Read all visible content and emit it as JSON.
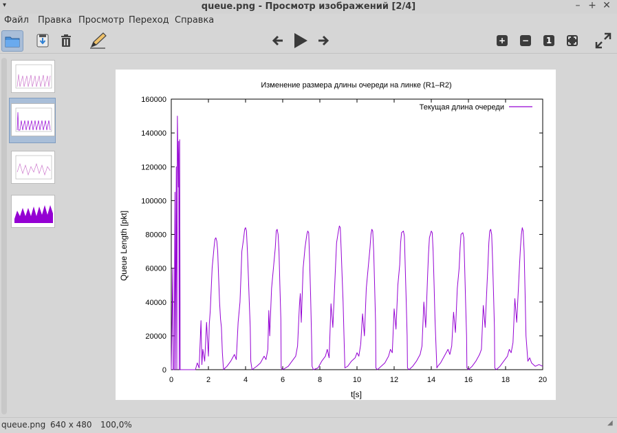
{
  "window": {
    "title": "queue.png - Просмотр изображений [2/4]",
    "menu_glyph": "▾",
    "minimize": "–",
    "maximize": "+",
    "close": "✕"
  },
  "menubar": {
    "items": [
      "Файл",
      "Правка",
      "Просмотр",
      "Переход",
      "Справка"
    ]
  },
  "toolbar": {
    "icons": [
      "folder-icon",
      "save-icon",
      "trash-icon",
      "edit-icon",
      "arrow-left-icon",
      "play-icon",
      "arrow-right-icon",
      "zoom-in-icon",
      "zoom-out-icon",
      "zoom-100-icon",
      "zoom-fit-icon",
      "fullscreen-icon"
    ],
    "zoom_in": "+",
    "zoom_out": "−",
    "zoom_100": "1"
  },
  "status": {
    "filename": "queue.png",
    "dimensions": "640 x 480",
    "zoom": "100,0%"
  },
  "colors": {
    "series": "#9400d3",
    "selection": "#a9bed8"
  },
  "chart_data": {
    "type": "line",
    "title": "Изменение размера длины очереди на линке (R1–R2)",
    "xlabel": "t[s]",
    "ylabel": "Queue Length [pkt]",
    "xlim": [
      0,
      20
    ],
    "ylim": [
      0,
      160000
    ],
    "xticks": [
      0,
      2,
      4,
      6,
      8,
      10,
      12,
      14,
      16,
      18,
      20
    ],
    "yticks": [
      0,
      20000,
      40000,
      60000,
      80000,
      100000,
      120000,
      140000,
      160000
    ],
    "legend_position": "top-right",
    "series": [
      {
        "name": "Текущая длина очереди",
        "x": [
          0,
          0.08,
          0.1,
          0.15,
          0.2,
          0.22,
          0.27,
          0.3,
          0.33,
          0.38,
          0.4,
          0.43,
          0.45,
          0.48,
          0.5,
          0.52,
          0.55,
          0.57,
          0.6,
          0.62,
          0.65,
          0.68,
          1.3,
          1.4,
          1.5,
          1.6,
          1.65,
          1.7,
          1.8,
          1.9,
          2.0,
          2.05,
          2.1,
          2.2,
          2.3,
          2.35,
          2.4,
          2.45,
          2.5,
          2.55,
          2.6,
          2.65,
          2.7,
          2.75,
          2.8,
          2.82,
          2.9,
          3.0,
          3.2,
          3.4,
          3.5,
          3.6,
          3.7,
          3.75,
          3.8,
          3.9,
          3.95,
          4.0,
          4.05,
          4.1,
          4.15,
          4.2,
          4.25,
          4.28,
          4.35,
          4.6,
          4.8,
          5.0,
          5.1,
          5.2,
          5.25,
          5.3,
          5.4,
          5.5,
          5.6,
          5.65,
          5.7,
          5.75,
          5.8,
          5.85,
          5.9,
          5.92,
          6.0,
          6.3,
          6.5,
          6.7,
          6.8,
          6.9,
          6.95,
          7.0,
          7.1,
          7.2,
          7.3,
          7.35,
          7.4,
          7.45,
          7.5,
          7.55,
          7.58,
          7.65,
          7.9,
          8.1,
          8.3,
          8.4,
          8.5,
          8.6,
          8.7,
          8.8,
          8.85,
          8.9,
          9.0,
          9.05,
          9.1,
          9.15,
          9.2,
          9.25,
          9.3,
          9.35,
          9.5,
          9.7,
          9.9,
          10.0,
          10.1,
          10.2,
          10.3,
          10.4,
          10.5,
          10.6,
          10.7,
          10.75,
          10.8,
          10.85,
          10.9,
          10.95,
          11.0,
          11.02,
          11.1,
          11.3,
          11.5,
          11.7,
          11.8,
          11.9,
          12.0,
          12.1,
          12.2,
          12.3,
          12.35,
          12.4,
          12.5,
          12.55,
          12.6,
          12.65,
          12.7,
          12.72,
          12.8,
          13.0,
          13.2,
          13.4,
          13.5,
          13.6,
          13.7,
          13.8,
          13.85,
          13.9,
          14.0,
          14.05,
          14.1,
          14.15,
          14.2,
          14.25,
          14.3,
          14.35,
          14.5,
          14.7,
          14.9,
          15.0,
          15.1,
          15.2,
          15.3,
          15.4,
          15.5,
          15.55,
          15.6,
          15.7,
          15.75,
          15.8,
          15.85,
          15.9,
          15.92,
          16.0,
          16.2,
          16.4,
          16.6,
          16.7,
          16.8,
          16.9,
          17.0,
          17.05,
          17.1,
          17.15,
          17.2,
          17.25,
          17.3,
          17.35,
          17.4,
          17.42,
          17.5,
          17.7,
          17.9,
          18.1,
          18.2,
          18.3,
          18.4,
          18.5,
          18.6,
          18.7,
          18.75,
          18.8,
          18.85,
          18.9,
          18.95,
          19.0,
          19.05,
          19.1,
          19.2,
          19.3,
          19.4,
          19.6,
          19.8,
          20
        ],
        "y": [
          0,
          60000,
          0,
          0,
          105000,
          0,
          120000,
          0,
          150000,
          108000,
          135000,
          0,
          136000,
          0,
          0,
          0,
          0,
          0,
          0,
          0,
          0,
          0,
          0,
          4000,
          1000,
          29000,
          3000,
          12000,
          5000,
          28000,
          8000,
          27000,
          35000,
          60000,
          72000,
          77000,
          78000,
          76000,
          70000,
          55000,
          40000,
          30000,
          25000,
          10000,
          2000,
          0,
          1000,
          2000,
          5000,
          9000,
          6000,
          28000,
          40000,
          55000,
          70000,
          78000,
          83000,
          84000,
          82000,
          70000,
          55000,
          40000,
          25000,
          5000,
          0,
          2000,
          4000,
          8000,
          6000,
          12000,
          35000,
          20000,
          48000,
          60000,
          72000,
          82000,
          83000,
          80000,
          70000,
          50000,
          30000,
          1000,
          0,
          2000,
          5000,
          8000,
          14000,
          38000,
          45000,
          28000,
          60000,
          72000,
          80000,
          82000,
          81000,
          65000,
          45000,
          20000,
          2000,
          0,
          1000,
          5000,
          8000,
          12000,
          7000,
          39000,
          25000,
          50000,
          62000,
          75000,
          82000,
          85000,
          84000,
          70000,
          55000,
          40000,
          20000,
          1000,
          2000,
          5000,
          7000,
          10000,
          8000,
          15000,
          33000,
          20000,
          48000,
          60000,
          72000,
          80000,
          83000,
          82000,
          70000,
          50000,
          28000,
          1000,
          0,
          2000,
          4000,
          8000,
          12000,
          10000,
          36000,
          24000,
          50000,
          62000,
          75000,
          81000,
          82000,
          79000,
          60000,
          40000,
          20000,
          1000,
          0,
          2000,
          5000,
          9000,
          14000,
          40000,
          25000,
          55000,
          68000,
          78000,
          82000,
          81000,
          70000,
          50000,
          30000,
          15000,
          1000,
          2000,
          4000,
          8000,
          12000,
          9000,
          14000,
          34000,
          22000,
          48000,
          60000,
          72000,
          80000,
          81000,
          78000,
          60000,
          40000,
          20000,
          1000,
          0,
          2000,
          5000,
          9000,
          12000,
          38000,
          25000,
          50000,
          62000,
          75000,
          82000,
          83000,
          80000,
          65000,
          45000,
          25000,
          1000,
          0,
          2000,
          5000,
          8000,
          12000,
          10000,
          16000,
          42000,
          28000,
          50000,
          62000,
          72000,
          80000,
          84000,
          82000,
          70000,
          45000,
          20000,
          5000,
          7000,
          4000,
          2000,
          3000,
          2000
        ]
      }
    ]
  }
}
